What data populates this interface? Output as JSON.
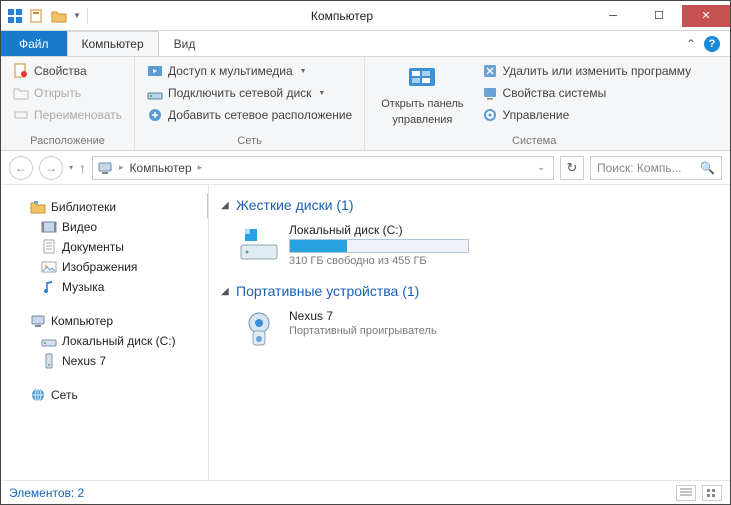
{
  "window": {
    "title": "Компьютер"
  },
  "tabs": {
    "file": "Файл",
    "computer": "Компьютер",
    "view": "Вид"
  },
  "ribbon": {
    "location": {
      "properties": "Свойства",
      "open": "Открыть",
      "rename": "Переименовать",
      "label": "Расположение"
    },
    "network": {
      "media": "Доступ к мультимедиа",
      "map_drive": "Подключить сетевой диск",
      "add_location": "Добавить сетевое расположение",
      "label": "Сеть"
    },
    "system": {
      "control_panel_line1": "Открыть панель",
      "control_panel_line2": "управления",
      "uninstall": "Удалить или изменить программу",
      "sys_props": "Свойства системы",
      "manage": "Управление",
      "label": "Система"
    }
  },
  "address": {
    "segment": "Компьютер"
  },
  "search": {
    "placeholder": "Поиск: Компь..."
  },
  "tree": {
    "libraries": "Библиотеки",
    "video": "Видео",
    "documents": "Документы",
    "pictures": "Изображения",
    "music": "Музыка",
    "computer": "Компьютер",
    "local_disk": "Локальный диск (C:)",
    "nexus": "Nexus 7",
    "network": "Сеть"
  },
  "categories": {
    "hdd": {
      "title": "Жесткие диски (1)"
    },
    "portable": {
      "title": "Портативные устройства (1)"
    }
  },
  "devices": {
    "local_c": {
      "name": "Локальный диск (C:)",
      "sub": "310 ГБ свободно из 455 ГБ",
      "used_pct": 32
    },
    "nexus": {
      "name": "Nexus 7",
      "sub": "Портативный проигрыватель"
    }
  },
  "status": {
    "items": "Элементов: 2"
  }
}
